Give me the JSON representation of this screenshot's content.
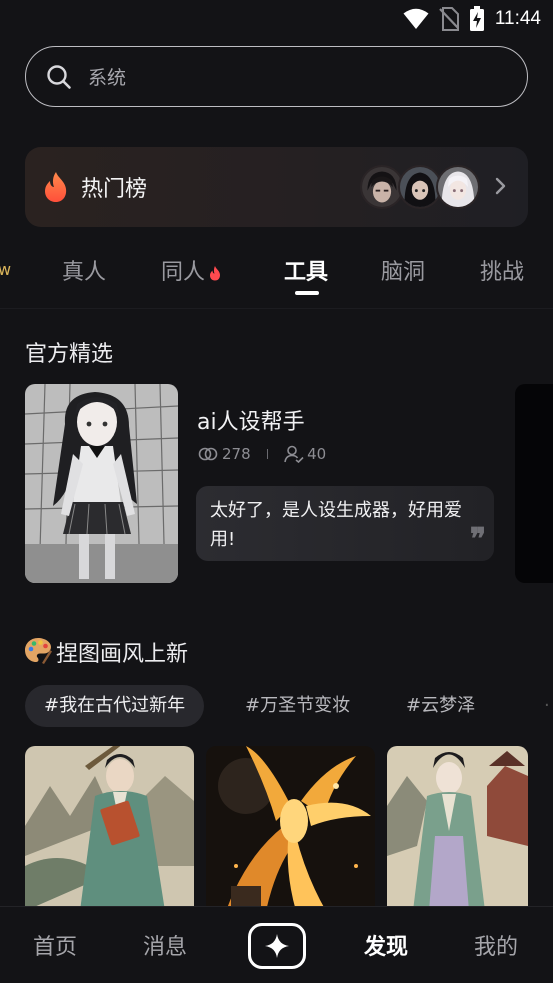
{
  "status_bar": {
    "time": "11:44"
  },
  "search": {
    "placeholder": "系统"
  },
  "hot_list": {
    "title": "热门榜"
  },
  "tabs": [
    {
      "label": "w"
    },
    {
      "label": "真人"
    },
    {
      "label": "同人"
    },
    {
      "label": "工具"
    },
    {
      "label": "脑洞"
    },
    {
      "label": "挑战"
    }
  ],
  "official_picks": {
    "title": "官方精选",
    "items": [
      {
        "name": "ai人设帮手",
        "views": "278",
        "followers": "40",
        "quote": "太好了，是人设生成器，好用爱用!",
        "quote_mark": "❞"
      }
    ]
  },
  "pinch_style": {
    "title": "捏图画风上新",
    "chips": [
      {
        "label": "#我在古代过新年"
      },
      {
        "label": "#万圣节变妆"
      },
      {
        "label": "#云梦泽"
      }
    ]
  },
  "bottom_nav": {
    "items": [
      {
        "label": "首页"
      },
      {
        "label": "消息"
      },
      {
        "label": "发现"
      },
      {
        "label": "我的"
      }
    ]
  },
  "colors": {
    "background": "#131316",
    "fire": "#ff6a3d",
    "active_tab": "#ffffff"
  }
}
